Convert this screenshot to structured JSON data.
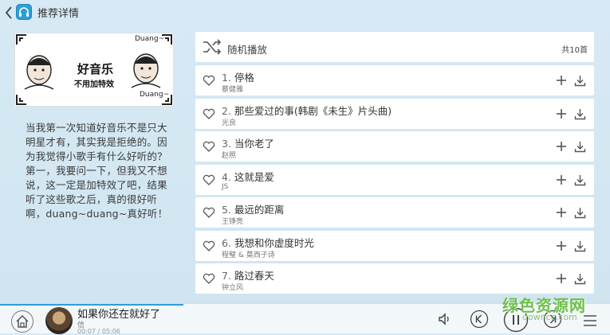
{
  "header": {
    "title": "推荐详情"
  },
  "cover": {
    "caption_main": "好音乐",
    "caption_sub": "不用加特效",
    "duang_top": "Duang~",
    "duang_bottom": "Duang~"
  },
  "description": "当我第一次知道好音乐不是只大明星才有，其实我是拒绝的。因为我觉得小歌手有什么好听的？第一，我要问一下，但我又不想说，这一定是加特效了吧，结果听了这些歌之后，真的很好听啊，duang~duang~真好听！",
  "playlist": {
    "shuffle_label": "随机播放",
    "count_label": "共10首",
    "songs": [
      {
        "num": "1.",
        "title": "停格",
        "artist": "蔡健雅"
      },
      {
        "num": "2.",
        "title": "那些爱过的事(韩剧《未生》片头曲)",
        "artist": "光良"
      },
      {
        "num": "3.",
        "title": "当你老了",
        "artist": "赵照"
      },
      {
        "num": "4.",
        "title": "这就是爱",
        "artist": "JS"
      },
      {
        "num": "5.",
        "title": "最远的距离",
        "artist": "王铮亮"
      },
      {
        "num": "6.",
        "title": "我想和你虚度时光",
        "artist": "程璧 & 莫西子诗"
      },
      {
        "num": "7.",
        "title": "路过春天",
        "artist": "钟立风"
      }
    ]
  },
  "player": {
    "now_title": "如果你还在就好了",
    "now_artist": "信",
    "now_time": "00:07 / 05:06",
    "progress": 0.3
  },
  "watermark": {
    "text": "绿色资源网",
    "url": "downcc.com"
  },
  "colors": {
    "accent": "#2f9ed8",
    "icon": "#666666",
    "watermark": "#6cc04a"
  },
  "icons": {
    "back": "chevron-left-icon",
    "app": "headphones-icon",
    "shuffle": "shuffle-icon",
    "heart": "heart-icon",
    "add": "plus-icon",
    "download": "download-icon",
    "home": "home-icon",
    "volume": "speaker-icon",
    "prev": "previous-icon",
    "pause": "pause-icon",
    "next": "next-icon",
    "menu": "menu-icon"
  }
}
